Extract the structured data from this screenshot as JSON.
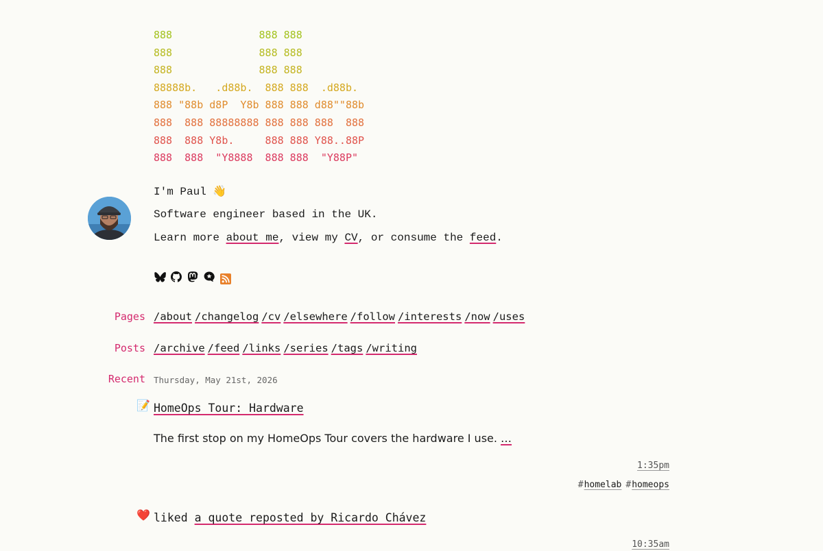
{
  "banner": {
    "lines": [
      {
        "text": "888              888 888",
        "color": "#a3c21e"
      },
      {
        "text": "888              888 888",
        "color": "#b5bb1f"
      },
      {
        "text": "888              888 888",
        "color": "#c4b31f"
      },
      {
        "text": "88888b.   .d88b.  888 888  .d88b.",
        "color": "#d4a81f"
      },
      {
        "text": "888 \"88b d8P  Y8b 888 888 d88\"\"88b",
        "color": "#e08c2e"
      },
      {
        "text": "888  888 88888888 888 888 888  888",
        "color": "#e2703c"
      },
      {
        "text": "888  888 Y8b.     888 888 Y88..88P",
        "color": "#e0534c"
      },
      {
        "text": "888  888  \"Y8888  888 888  \"Y88P\"",
        "color": "#db3a5e"
      }
    ]
  },
  "intro": {
    "greeting": "I'm Paul 👋",
    "tagline": "Software engineer based in the UK.",
    "learn_prefix": "Learn more ",
    "about_link": "about me",
    "learn_mid1": ", view my ",
    "cv_link": "CV",
    "learn_mid2": ", or consume the ",
    "feed_link": "feed",
    "learn_suffix": "."
  },
  "social": {
    "icons": [
      "bluesky-icon",
      "github-icon",
      "mastodon-icon",
      "micro-blog-icon",
      "rss-icon"
    ],
    "rss_color": "#e8802a"
  },
  "nav": {
    "pages_label": "Pages",
    "pages": [
      "/about",
      "/changelog",
      "/cv",
      "/elsewhere",
      "/follow",
      "/interests",
      "/now",
      "/uses"
    ],
    "posts_label": "Posts",
    "posts": [
      "/archive",
      "/feed",
      "/links",
      "/series",
      "/tags",
      "/writing"
    ],
    "recent_label": "Recent"
  },
  "recent": {
    "date": "Thursday, May 21st, 2026",
    "entry1": {
      "emoji": "📝",
      "title": "HomeOps Tour: Hardware",
      "summary": "The first stop on my HomeOps Tour covers the hardware I use. ",
      "more": "…",
      "time": "1:35pm",
      "tags": [
        "homelab",
        "homeops"
      ],
      "tag_hash": "#"
    },
    "entry2": {
      "emoji": "❤️",
      "prefix": "liked ",
      "link": "a quote reposted by Ricardo Chávez",
      "time": "10:35am"
    }
  },
  "colors": {
    "accent": "#d42a6e",
    "background": "#fbfbf7",
    "text": "#1b1b1b"
  }
}
